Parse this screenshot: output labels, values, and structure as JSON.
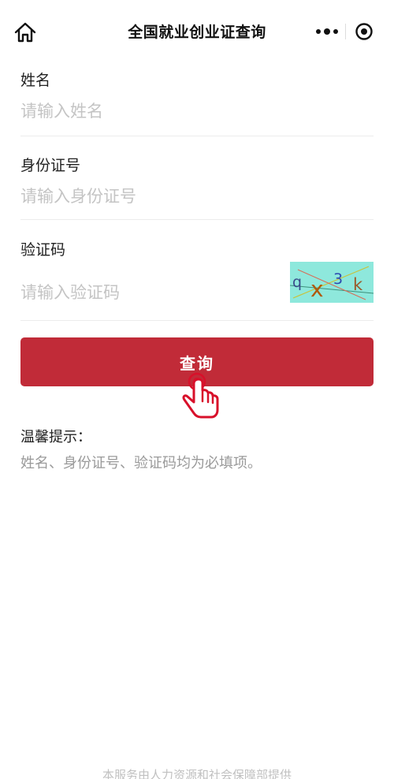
{
  "nav": {
    "title": "全国就业创业证查询",
    "home_icon": "home-icon",
    "more_icon": "more-icon",
    "close_icon": "target-icon"
  },
  "form": {
    "name": {
      "label": "姓名",
      "placeholder": "请输入姓名"
    },
    "id_number": {
      "label": "身份证号",
      "placeholder": "请输入身份证号"
    },
    "captcha": {
      "label": "验证码",
      "placeholder": "请输入验证码",
      "image_chars": [
        "q",
        "x",
        "3",
        "k"
      ]
    }
  },
  "query_button": {
    "label": "查询"
  },
  "tips": {
    "title": "温馨提示：",
    "text": "姓名、身份证号、验证码均为必填项。"
  },
  "footer": {
    "text": "本服务由人力资源和社会保障部提供"
  },
  "colors": {
    "primary": "#c12b38",
    "captcha_bg": "#8ee8dc",
    "placeholder": "#c4c4c4",
    "tip_text": "#9a9a9a"
  }
}
